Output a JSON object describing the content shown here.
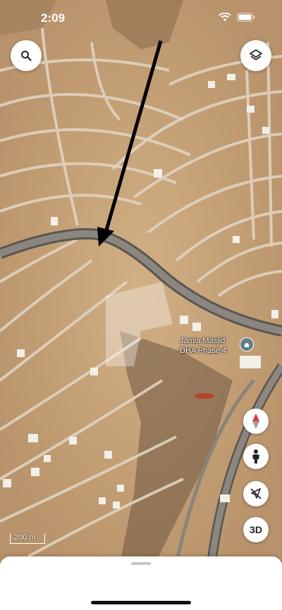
{
  "status_bar": {
    "time": "2:09"
  },
  "map": {
    "place_label_line1": "Jamia Masjid",
    "place_label_line2": "DHA Phase 4",
    "place_icon": "mosque-icon",
    "scale_text": "200 m"
  },
  "controls": {
    "search_icon": "search-icon",
    "layers_icon": "layers-icon",
    "compass_icon": "compass-icon",
    "street_view_icon": "pegman-icon",
    "location_icon": "location-off-icon",
    "threed_label": "3D"
  },
  "colors": {
    "terrain": "#c9a67a",
    "road": "#d8cdbd",
    "arrow": "#000000",
    "compass_red": "#e53935"
  }
}
